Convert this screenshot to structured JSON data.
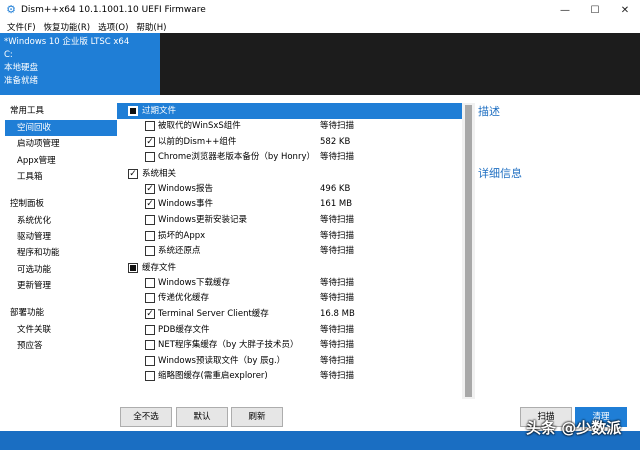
{
  "window": {
    "title": "Dism++x64 10.1.1001.10 UEFI Firmware",
    "minimize_glyph": "—",
    "maximize_glyph": "☐",
    "close_glyph": "✕"
  },
  "menu": [
    "文件(F)",
    "恢复功能(R)",
    "选项(O)",
    "帮助(H)"
  ],
  "system_info": {
    "os": "*Windows 10 企业版 LTSC x64",
    "drive": "C:",
    "disk": "本地硬盘",
    "status": "准备就绪"
  },
  "sidebar": {
    "groups": [
      {
        "label": "常用工具",
        "items": [
          "空间回收",
          "启动项管理",
          "Appx管理",
          "工具箱"
        ]
      },
      {
        "label": "控制面板",
        "items": [
          "系统优化",
          "驱动管理",
          "程序和功能",
          "可选功能",
          "更新管理"
        ]
      },
      {
        "label": "部署功能",
        "items": [
          "文件关联",
          "预应答"
        ]
      }
    ],
    "active_item": "空间回收"
  },
  "cleanup": {
    "categories": [
      {
        "label": "过期文件",
        "state": "partial",
        "highlighted": true,
        "rows": [
          {
            "label": "被取代的WinSxS组件",
            "value": "等待扫描",
            "checked": false
          },
          {
            "label": "以前的Dism++组件",
            "value": "582 KB",
            "checked": true
          },
          {
            "label": "Chrome浏览器老版本备份（by Honry）",
            "value": "等待扫描",
            "checked": false
          }
        ]
      },
      {
        "label": "系统相关",
        "state": "checked",
        "highlighted": false,
        "rows": [
          {
            "label": "Windows报告",
            "value": "496 KB",
            "checked": true
          },
          {
            "label": "Windows事件",
            "value": "161 MB",
            "checked": true
          },
          {
            "label": "Windows更新安装记录",
            "value": "等待扫描",
            "checked": false
          },
          {
            "label": "损坏的Appx",
            "value": "等待扫描",
            "checked": false
          },
          {
            "label": "系统还原点",
            "value": "等待扫描",
            "checked": false
          }
        ]
      },
      {
        "label": "缓存文件",
        "state": "partial",
        "highlighted": false,
        "rows": [
          {
            "label": "Windows下载缓存",
            "value": "等待扫描",
            "checked": false
          },
          {
            "label": "传递优化缓存",
            "value": "等待扫描",
            "checked": false
          },
          {
            "label": "Terminal Server Client缓存",
            "value": "16.8 MB",
            "checked": true
          },
          {
            "label": "PDB缓存文件",
            "value": "等待扫描",
            "checked": false
          },
          {
            "label": "NET程序集缓存（by 大胖子技术员）",
            "value": "等待扫描",
            "checked": false
          },
          {
            "label": "Windows预读取文件（by 辰g.）",
            "value": "等待扫描",
            "checked": false
          },
          {
            "label": "缩略图缓存(需重启explorer)",
            "value": "等待扫描",
            "checked": false
          }
        ]
      }
    ],
    "buttons": {
      "select_none": "全不选",
      "default": "默认",
      "refresh": "刷新"
    }
  },
  "panel": {
    "description_heading": "描述",
    "details_heading": "详细信息",
    "scan_button": "扫描",
    "clean_button": "清理"
  },
  "watermark": "头条 @少数派",
  "colors": {
    "accent": "#1f7ed6",
    "dark_bar": "#1c1c1c",
    "frame": "#1a6ec2"
  }
}
